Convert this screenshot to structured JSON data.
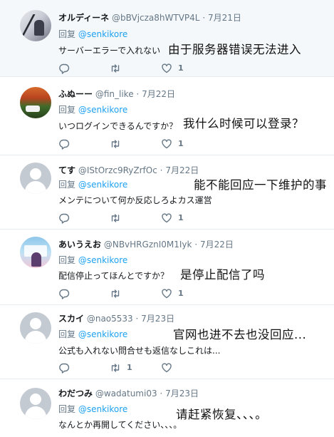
{
  "colors": {
    "mention": "#1da1f2",
    "muted": "#657786",
    "text": "#14171a",
    "divider": "#e6ecf0",
    "highlight_bg": "#f5f8fa"
  },
  "tweets": [
    {
      "name": "オルディーネ",
      "handle": "@bBVjcza8hWTVP4L",
      "sep": "·",
      "date": "7月21日",
      "reply_prefix": "回复",
      "reply_to": "@senkikore",
      "text": "サーバーエラーで入れない",
      "overlay": "由于服务器错误无法进入",
      "avatar": "anime-figure-avatar",
      "reply_count": "",
      "retweet_count": "",
      "like_count": "1"
    },
    {
      "name": "ふぬーー",
      "handle": "@fin_like",
      "sep": "·",
      "date": "7月22日",
      "reply_prefix": "回复",
      "reply_to": "@senkikore",
      "text": "いつログインできるんですか？",
      "overlay": "我什么时候可以登录？",
      "avatar": "autumn-car-avatar",
      "reply_count": "",
      "retweet_count": "",
      "like_count": "1"
    },
    {
      "name": "てす",
      "handle": "@IStOrzc9RyZrfOc",
      "sep": "·",
      "date": "7月22日",
      "reply_prefix": "回复",
      "reply_to": "@senkikore",
      "text": "メンテについて何か反応しろよカス運営",
      "overlay": "能不能回应一下维护的事",
      "avatar": "default-avatar",
      "reply_count": "",
      "retweet_count": "",
      "like_count": "1"
    },
    {
      "name": "あいうえお",
      "handle": "@NBvHRGznI0M1Iyk",
      "sep": "·",
      "date": "7月22日",
      "reply_prefix": "回复",
      "reply_to": "@senkikore",
      "text": "配信停止ってほんとですか？",
      "overlay": "是停止配信了吗",
      "avatar": "anime-girl-avatar",
      "reply_count": "",
      "retweet_count": "",
      "like_count": "1"
    },
    {
      "name": "スカイ",
      "handle": "@nao5533",
      "sep": "·",
      "date": "7月23日",
      "reply_prefix": "回复",
      "reply_to": "@senkikore",
      "text": "公式も入れない問合せも返信なしこれは...",
      "overlay": "官网也进不去也没回应...",
      "avatar": "default-avatar",
      "reply_count": "",
      "retweet_count": "1",
      "like_count": ""
    },
    {
      "name": "わだつみ",
      "handle": "@wadatumi03",
      "sep": "·",
      "date": "7月23日",
      "reply_prefix": "回复",
      "reply_to": "@senkikore",
      "text": "なんとか再開してください、、、。",
      "overlay": "请赶紧恢复、、、。",
      "avatar": "default-avatar",
      "reply_count": "",
      "retweet_count": "",
      "like_count": ""
    }
  ],
  "icons": {
    "reply": "reply-icon",
    "retweet": "retweet-icon",
    "like": "heart-icon"
  }
}
